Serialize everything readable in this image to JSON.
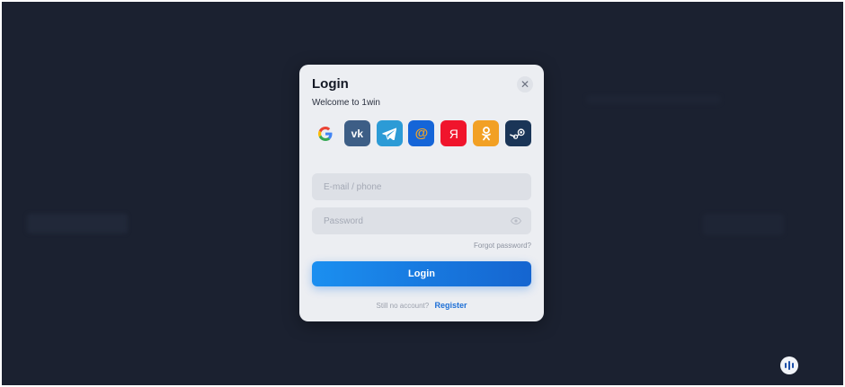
{
  "modal": {
    "title": "Login",
    "subtitle": "Welcome to 1win",
    "close_icon": "close-icon",
    "social_buttons": [
      {
        "icon": "google-icon",
        "glyph": "G",
        "color": "#eceef2"
      },
      {
        "icon": "vk-icon",
        "glyph": "vk",
        "color": "#3d5e86"
      },
      {
        "icon": "telegram-icon",
        "glyph": "",
        "color": "#2c9bd6"
      },
      {
        "icon": "mailru-icon",
        "glyph": "@",
        "color": "#1565d8"
      },
      {
        "icon": "yandex-icon",
        "glyph": "Я",
        "color": "#f0142c"
      },
      {
        "icon": "odnoklassniki-icon",
        "glyph": "",
        "color": "#f2a024"
      },
      {
        "icon": "steam-icon",
        "glyph": "",
        "color": "#1a3557"
      }
    ],
    "email": {
      "value": "",
      "placeholder": "E-mail / phone"
    },
    "password": {
      "value": "",
      "placeholder": "Password",
      "toggle_icon": "eye-icon"
    },
    "forgot_label": "Forgot password?",
    "login_label": "Login",
    "register_prompt": "Still no account?",
    "register_label": "Register"
  },
  "support": {
    "icon": "sound-bars-icon"
  },
  "colors": {
    "background": "#1b2130",
    "modal": "#eceef2",
    "accent": "#1b8ff0",
    "register_link": "#1d6fd6"
  }
}
